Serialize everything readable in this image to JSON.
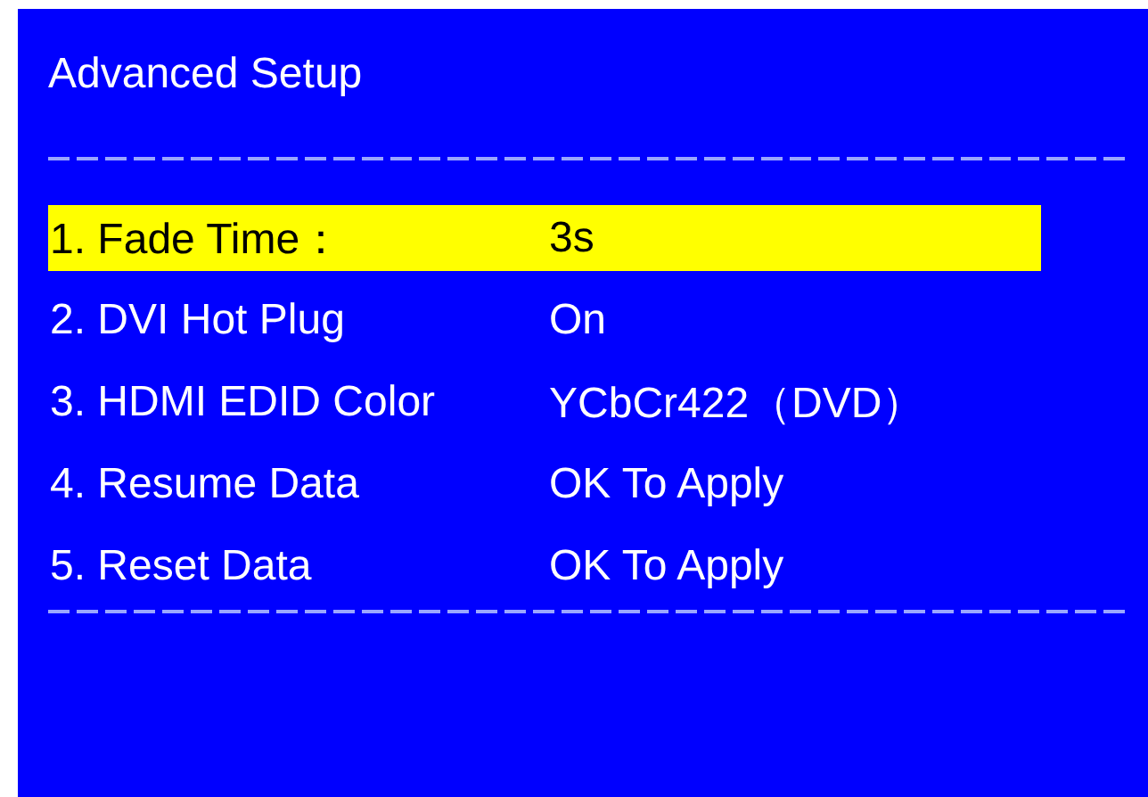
{
  "title": "Advanced Setup",
  "items": [
    {
      "label": "1. Fade Time：",
      "value": "3s",
      "selected": true
    },
    {
      "label": "2. DVI Hot Plug",
      "value": "On",
      "selected": false
    },
    {
      "label": "3. HDMI EDID Color",
      "value": "YCbCr422（DVD）",
      "selected": false
    },
    {
      "label": "4. Resume Data",
      "value": "OK To Apply",
      "selected": false
    },
    {
      "label": "5. Reset Data",
      "value": "OK To Apply",
      "selected": false
    }
  ]
}
